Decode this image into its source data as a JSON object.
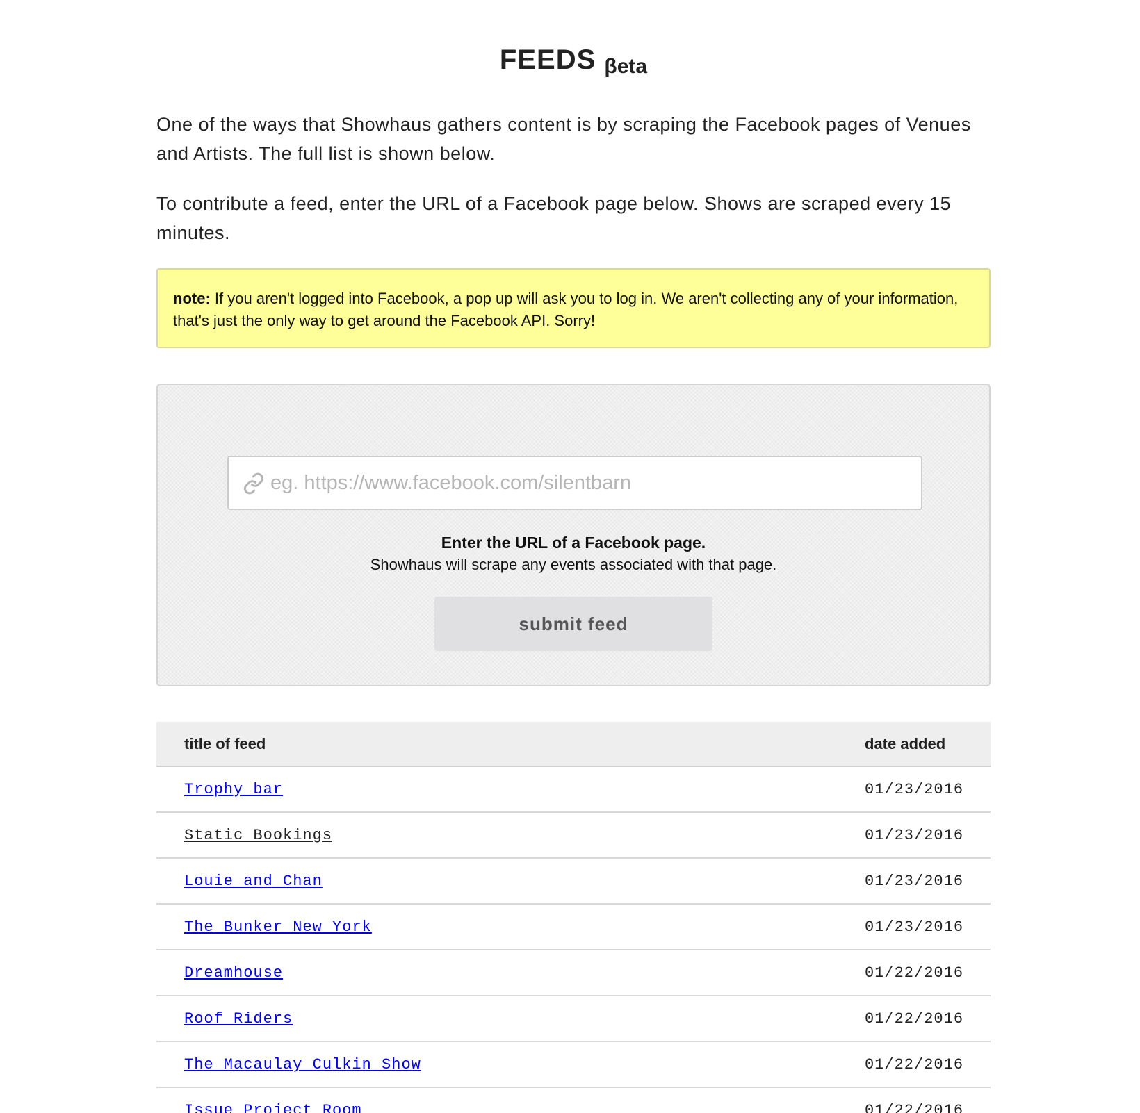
{
  "header": {
    "title": "FEEDS",
    "badge": "βeta"
  },
  "intro": {
    "paragraph1": "One of the ways that Showhaus gathers content is by scraping the Facebook pages of Venues and Artists. The full list is shown below.",
    "paragraph2": "To contribute a feed, enter the URL of a Facebook page below. Shows are scraped every 15 minutes."
  },
  "note": {
    "label": "note:",
    "text": " If you aren't logged into Facebook, a pop up will ask you to log in. We aren't collecting any of your information, that's just the only way to get around the Facebook API. Sorry!"
  },
  "form": {
    "input_value": "",
    "input_placeholder": "eg. https://www.facebook.com/silentbarn",
    "input_icon": "link-icon",
    "helper_strong": "Enter the URL of a Facebook page.",
    "helper_sub": "Showhaus will scrape any events associated with that page.",
    "submit_label": "submit feed"
  },
  "table": {
    "headers": {
      "title": "title of feed",
      "date": "date added"
    },
    "rows": [
      {
        "title": "Trophy bar",
        "date": "01/23/2016",
        "visited": false
      },
      {
        "title": "Static Bookings",
        "date": "01/23/2016",
        "visited": true
      },
      {
        "title": "Louie and Chan",
        "date": "01/23/2016",
        "visited": false
      },
      {
        "title": "The Bunker New York",
        "date": "01/23/2016",
        "visited": false
      },
      {
        "title": "Dreamhouse",
        "date": "01/22/2016",
        "visited": false
      },
      {
        "title": "Roof Riders",
        "date": "01/22/2016",
        "visited": false
      },
      {
        "title": "The Macaulay Culkin Show",
        "date": "01/22/2016",
        "visited": false
      },
      {
        "title": "Issue Project Room",
        "date": "01/22/2016",
        "visited": false
      }
    ]
  },
  "colors": {
    "link": "#0000ee",
    "note_background": "#ffff99",
    "button_background": "#e0e0e2"
  }
}
